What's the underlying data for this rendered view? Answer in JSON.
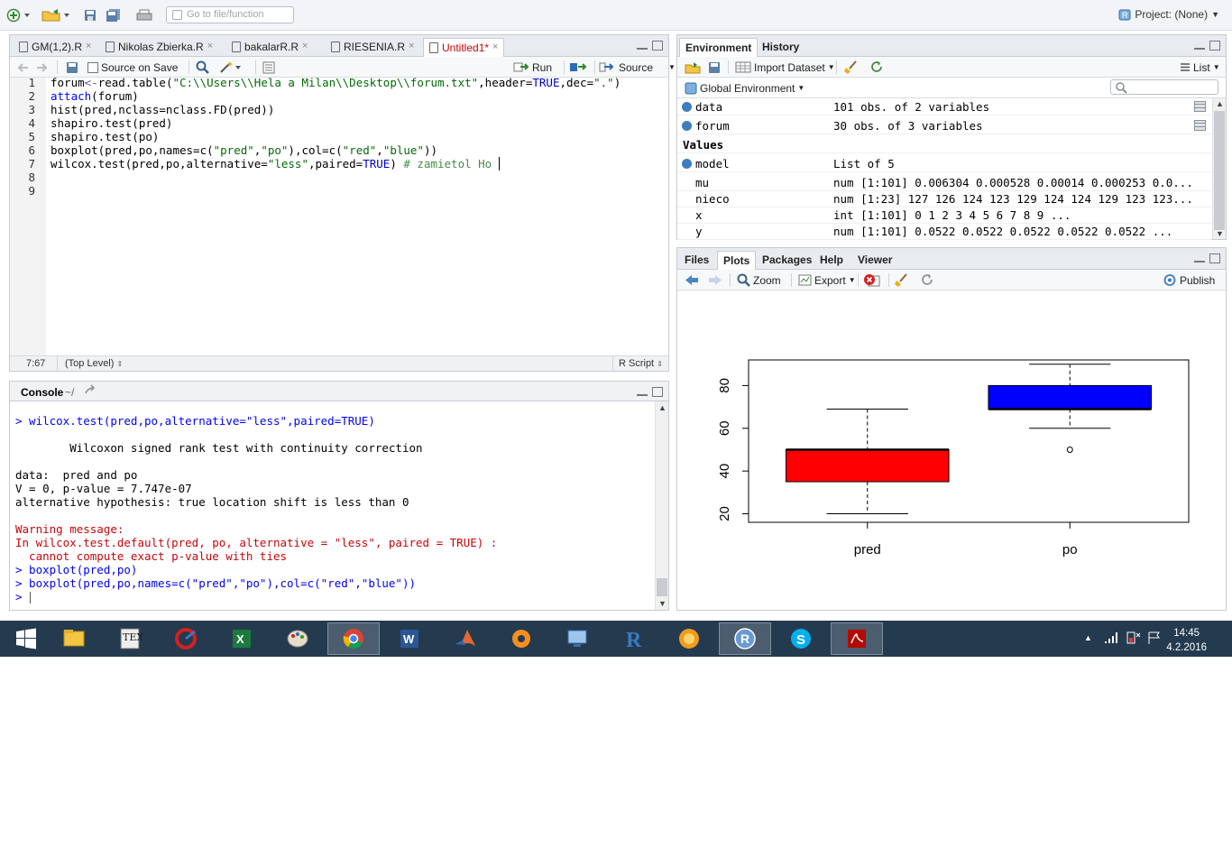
{
  "topbar": {
    "goto_placeholder": "Go to file/function",
    "project_label": "Project: (None)"
  },
  "editor": {
    "tabs": [
      {
        "label": "GM(1,2).R",
        "active": false
      },
      {
        "label": "Nikolas Zbierka.R",
        "active": false
      },
      {
        "label": "bakalarR.R",
        "active": false
      },
      {
        "label": "RIESENIA.R",
        "active": false
      },
      {
        "label": "Untitled1*",
        "active": true
      }
    ],
    "source_on_save": "Source on Save",
    "run_label": "Run",
    "source_label": "Source",
    "line_numbers": [
      "1",
      "2",
      "3",
      "4",
      "5",
      "6",
      "7",
      "8",
      "9"
    ],
    "status_pos": "7:67",
    "status_scope": "(Top Level)",
    "status_type": "R Script"
  },
  "console": {
    "title": "Console",
    "path": "~/",
    "lines": [
      {
        "text": "> wilcox.test(pred,po,alternative=\"less\",paired=TRUE)",
        "color": "#0000ff"
      },
      {
        "text": "",
        "color": "#000000"
      },
      {
        "text": "        Wilcoxon signed rank test with continuity correction",
        "color": "#000000"
      },
      {
        "text": "",
        "color": "#000000"
      },
      {
        "text": "data:  pred and po",
        "color": "#000000"
      },
      {
        "text": "V = 0, p-value = 7.747e-07",
        "color": "#000000"
      },
      {
        "text": "alternative hypothesis: true location shift is less than 0",
        "color": "#000000"
      },
      {
        "text": "",
        "color": "#000000"
      },
      {
        "text": "Warning message:",
        "color": "#c5060b"
      },
      {
        "text": "In wilcox.test.default(pred, po, alternative = \"less\", paired = TRUE) :",
        "color": "#c5060b"
      },
      {
        "text": "  cannot compute exact p-value with ties",
        "color": "#c5060b"
      },
      {
        "text": "> boxplot(pred,po)",
        "color": "#0000ff"
      },
      {
        "text": "> boxplot(pred,po,names=c(\"pred\",\"po\"),col=c(\"red\",\"blue\"))",
        "color": "#0000ff"
      },
      {
        "text": "> ",
        "color": "#0000ff"
      }
    ]
  },
  "env": {
    "tabs": [
      "Environment",
      "History"
    ],
    "import_label": "Import Dataset",
    "list_label": "List",
    "scope_label": "Global Environment",
    "values_header": "Values",
    "rows": [
      {
        "name": "data",
        "value": "101 obs. of 2 variables",
        "kind": "data"
      },
      {
        "name": "forum",
        "value": "30 obs. of 3 variables",
        "kind": "data"
      },
      {
        "name": "model",
        "value": "List of 5",
        "kind": "list"
      },
      {
        "name": "mu",
        "value": "num [1:101] 0.006304 0.000528 0.00014 0.000253 0.0...",
        "kind": "value"
      },
      {
        "name": "nieco",
        "value": "num [1:23] 127 126 124 123 129 124 124 129 123 123...",
        "kind": "value"
      },
      {
        "name": "x",
        "value": "int [1:101] 0 1 2 3 4 5 6 7 8 9 ...",
        "kind": "value"
      },
      {
        "name": "y",
        "value": "num [1:101] 0.0522 0.0522 0.0522 0.0522 0.0522 ...",
        "kind": "value"
      }
    ]
  },
  "files": {
    "tabs": [
      "Files",
      "Plots",
      "Packages",
      "Help",
      "Viewer"
    ],
    "active_tab": "Plots",
    "zoom_label": "Zoom",
    "export_label": "Export",
    "publish_label": "Publish"
  },
  "chart_data": {
    "type": "boxplot",
    "categories": [
      "pred",
      "po"
    ],
    "colors": [
      "#ff0000",
      "#0000ff"
    ],
    "boxes": [
      {
        "name": "pred",
        "whisker_low": 20,
        "q1": 35,
        "median": 50,
        "q3": 50,
        "whisker_high": 69,
        "outliers": []
      },
      {
        "name": "po",
        "whisker_low": 60,
        "q1": 69,
        "median": 69,
        "q3": 80,
        "whisker_high": 90,
        "outliers": [
          50
        ]
      }
    ],
    "yticks": [
      20,
      40,
      60,
      80
    ],
    "ylim": [
      16,
      92
    ],
    "title": "",
    "xlabel": "",
    "ylabel": ""
  },
  "taskbar": {
    "apps": [
      "file-explorer",
      "texmaker",
      "ccleaner",
      "excel",
      "paint",
      "chrome",
      "word",
      "matlab",
      "avast",
      "remote-desktop",
      "r",
      "firefox",
      "rstudio",
      "skype",
      "acrobat"
    ],
    "time": "14:45",
    "date": "4.2.2016"
  }
}
